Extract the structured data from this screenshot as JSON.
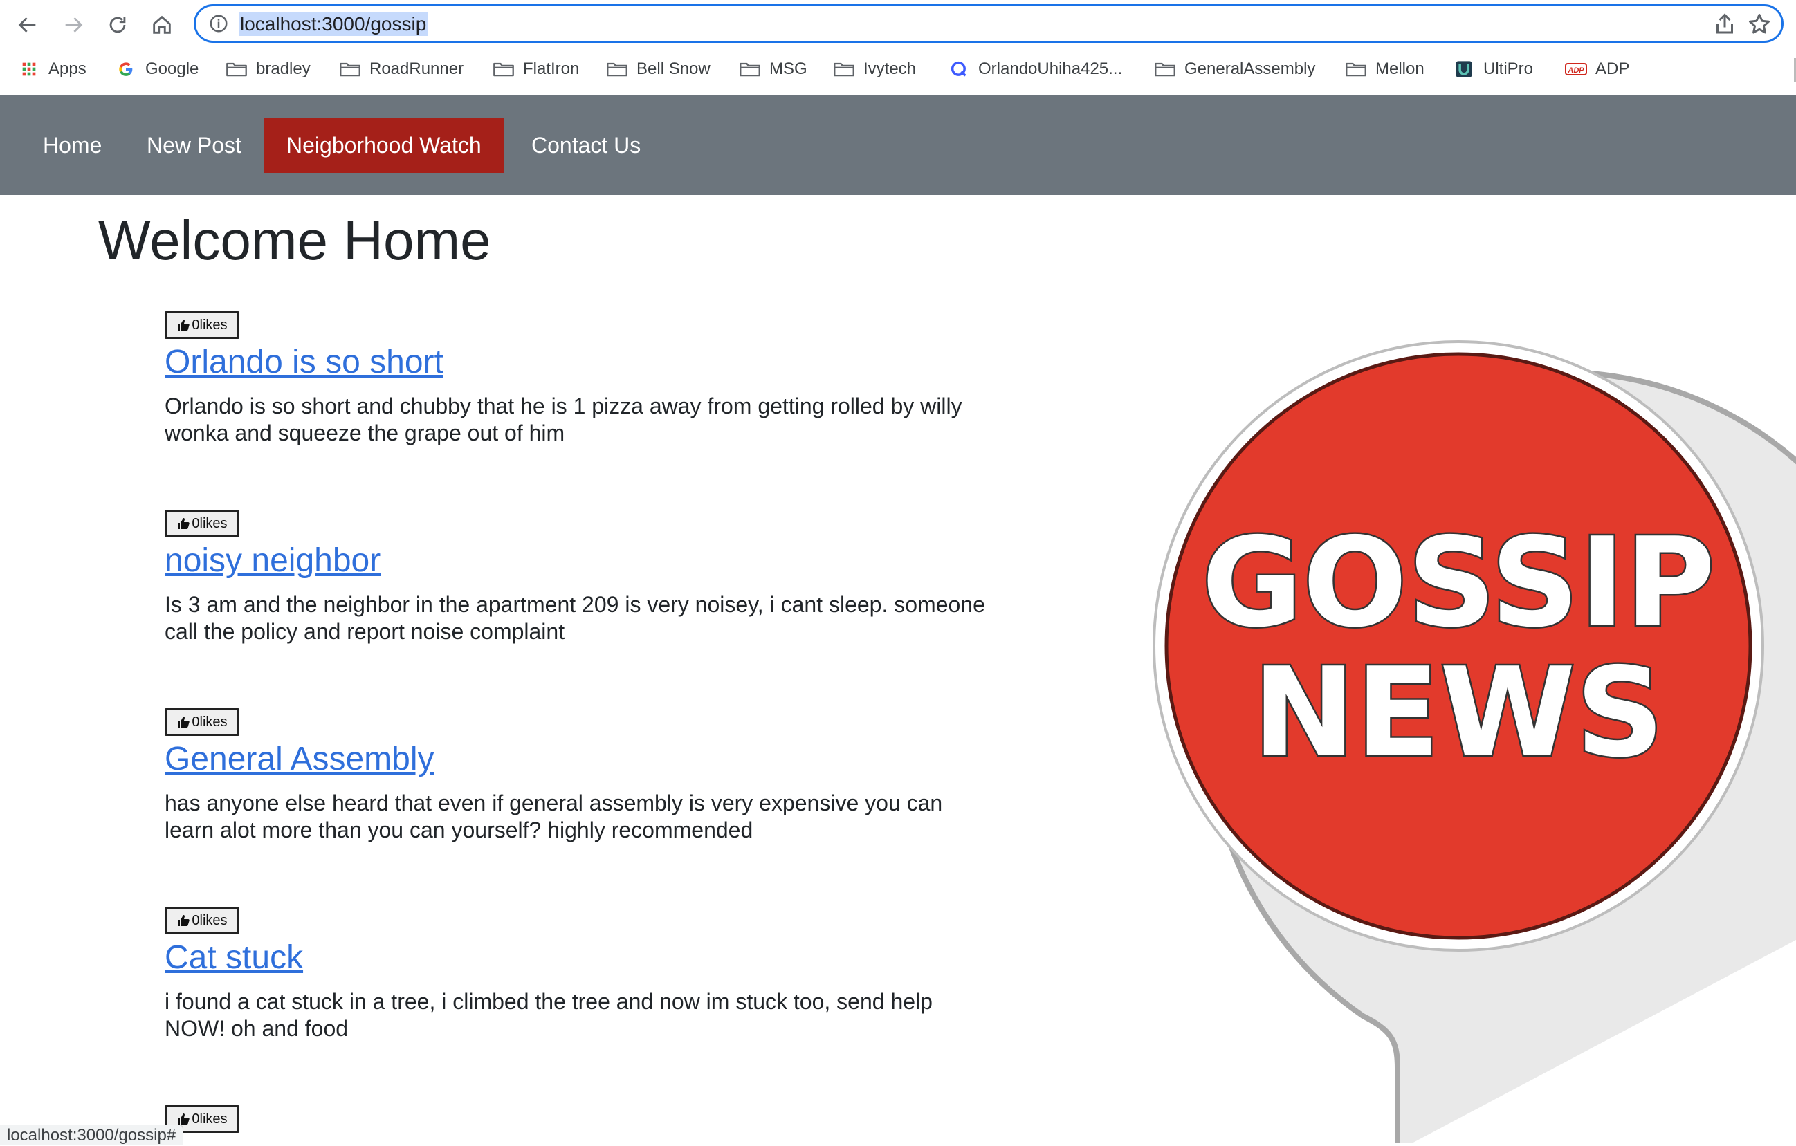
{
  "browser": {
    "url": "localhost:3000/gossip",
    "bookmarks": [
      {
        "label": "Apps",
        "icon": "apps-grid-icon"
      },
      {
        "label": "Google",
        "icon": "google-icon"
      },
      {
        "label": "bradley",
        "icon": "folder-icon"
      },
      {
        "label": "RoadRunner",
        "icon": "folder-icon"
      },
      {
        "label": "FlatIron",
        "icon": "folder-icon"
      },
      {
        "label": "Bell Snow",
        "icon": "folder-icon"
      },
      {
        "label": "MSG",
        "icon": "folder-icon"
      },
      {
        "label": "Ivytech",
        "icon": "folder-icon"
      },
      {
        "label": "OrlandoUhiha425...",
        "icon": "q-icon"
      },
      {
        "label": "GeneralAssembly",
        "icon": "folder-icon"
      },
      {
        "label": "Mellon",
        "icon": "folder-icon"
      },
      {
        "label": "UltiPro",
        "icon": "ultipro-icon"
      },
      {
        "label": "ADP",
        "icon": "adp-icon"
      }
    ],
    "status_url": "localhost:3000/gossip#"
  },
  "nav": {
    "items": [
      {
        "label": "Home"
      },
      {
        "label": "New Post"
      },
      {
        "label": "Neigborhood Watch",
        "active": true
      },
      {
        "label": "Contact Us"
      }
    ]
  },
  "main": {
    "title": "Welcome Home",
    "posts": [
      {
        "likes": "0likes",
        "title": "Orlando is so short",
        "body": "Orlando is so short and chubby that he is 1 pizza away from getting rolled by willy wonka and squeeze the grape out of him"
      },
      {
        "likes": "0likes",
        "title": "noisy neighbor",
        "body": "Is 3 am and the neighbor in the apartment 209 is very noisey, i cant sleep. someone call the policy and report noise complaint"
      },
      {
        "likes": "0likes",
        "title": "General Assembly",
        "body": "has anyone else heard that even if general assembly is very expensive you can learn alot more than you can yourself? highly recommended"
      },
      {
        "likes": "0likes",
        "title": "Cat stuck",
        "body": "i found a cat stuck in a tree, i climbed the tree and now im stuck too, send help NOW! oh and food"
      },
      {
        "likes": "0likes",
        "title": "",
        "body": ""
      }
    ]
  },
  "logo": {
    "line1": "GOSSIP",
    "line2": "NEWS",
    "color_red": "#e23a2c",
    "color_ring": "#e9e9e9"
  },
  "colors": {
    "nav_bg": "#6c757d",
    "nav_active": "#a52019",
    "link": "#2f6fdb",
    "focus_blue": "#1a73e8"
  }
}
